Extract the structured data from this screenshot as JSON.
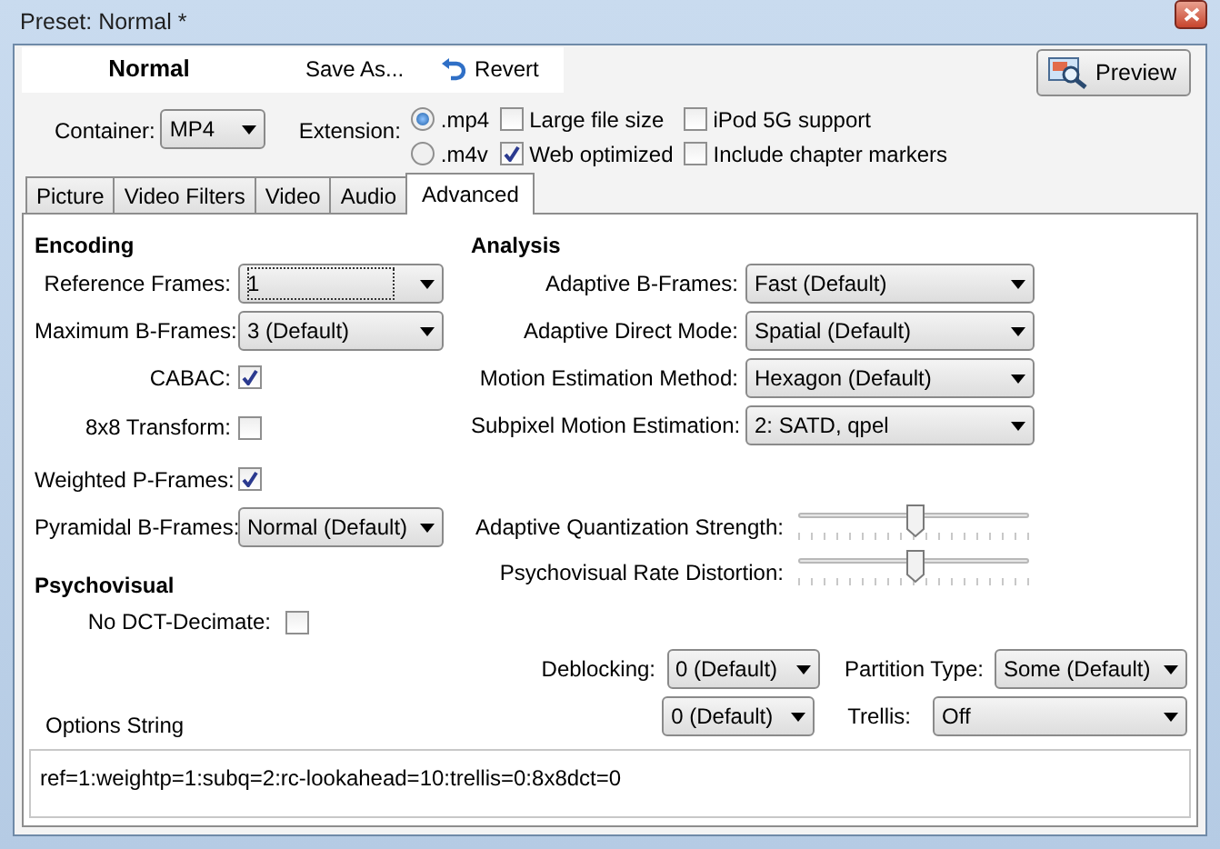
{
  "window": {
    "title": "Preset: Normal *"
  },
  "header": {
    "preset_name": "Normal",
    "save_as": "Save As...",
    "revert": "Revert",
    "preview": "Preview"
  },
  "container": {
    "label": "Container:",
    "value": "MP4"
  },
  "extension": {
    "label": "Extension:",
    "options": [
      {
        "label": ".mp4",
        "selected": true
      },
      {
        "label": ".m4v",
        "selected": false
      }
    ]
  },
  "options": [
    {
      "label": "Large file size",
      "checked": false
    },
    {
      "label": "Web optimized",
      "checked": true
    },
    {
      "label": "iPod 5G support",
      "checked": false
    },
    {
      "label": "Include chapter markers",
      "checked": false
    }
  ],
  "tabs": [
    {
      "label": "Picture",
      "selected": false
    },
    {
      "label": "Video Filters",
      "selected": false
    },
    {
      "label": "Video",
      "selected": false
    },
    {
      "label": "Audio",
      "selected": false
    },
    {
      "label": "Advanced",
      "selected": true
    }
  ],
  "encoding": {
    "heading": "Encoding",
    "rows": [
      {
        "kind": "select",
        "label": "Reference Frames:",
        "value": "1",
        "focused": true
      },
      {
        "kind": "select",
        "label": "Maximum B-Frames:",
        "value": "3 (Default)",
        "focused": false
      },
      {
        "kind": "checkbox",
        "label": "CABAC:",
        "checked": true
      },
      {
        "kind": "checkbox",
        "label": "8x8 Transform:",
        "checked": false
      },
      {
        "kind": "checkbox",
        "label": "Weighted P-Frames:",
        "checked": true
      },
      {
        "kind": "select",
        "label": "Pyramidal B-Frames:",
        "value": "Normal (Default)",
        "focused": false
      }
    ]
  },
  "psychovisual": {
    "heading": "Psychovisual",
    "rows": [
      {
        "kind": "checkbox",
        "label": "No DCT-Decimate:",
        "checked": false
      }
    ]
  },
  "analysis": {
    "heading": "Analysis",
    "rows": [
      {
        "kind": "select",
        "label": "Adaptive B-Frames:",
        "value": "Fast (Default)"
      },
      {
        "kind": "select",
        "label": "Adaptive Direct Mode:",
        "value": "Spatial (Default)"
      },
      {
        "kind": "select",
        "label": "Motion Estimation Method:",
        "value": "Hexagon (Default)"
      },
      {
        "kind": "select",
        "label": "Subpixel Motion Estimation:",
        "value": "2: SATD, qpel"
      },
      {
        "kind": "slider",
        "label": "Adaptive Quantization Strength:",
        "level": 0.5
      },
      {
        "kind": "slider",
        "label": "Psychovisual Rate Distortion:",
        "level": 0.5
      }
    ]
  },
  "deblocking": {
    "label": "Deblocking:",
    "values": [
      "0 (Default)",
      "0 (Default)"
    ]
  },
  "partition_type": {
    "label": "Partition Type:",
    "value": "Some (Default)"
  },
  "trellis": {
    "label": "Trellis:",
    "value": "Off"
  },
  "options_string": {
    "label": "Options String",
    "value": "ref=1:weightp=1:subq=2:rc-lookahead=10:trellis=0:8x8dct=0"
  }
}
